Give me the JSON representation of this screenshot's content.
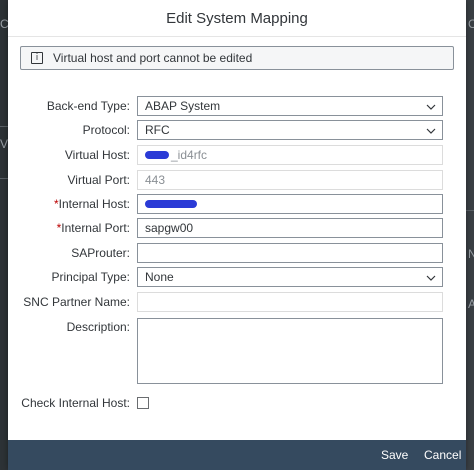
{
  "dialog": {
    "title": "Edit System Mapping"
  },
  "info": {
    "text": "Virtual host and port cannot be edited"
  },
  "form": {
    "backend_type": {
      "label": "Back-end Type:",
      "value": "ABAP System"
    },
    "protocol": {
      "label": "Protocol:",
      "value": "RFC"
    },
    "virtual_host": {
      "label": "Virtual Host:",
      "value_suffix": "_id4rfc"
    },
    "virtual_port": {
      "label": "Virtual Port:",
      "value": "443"
    },
    "internal_host": {
      "required_mark": "*",
      "label": "Internal Host:"
    },
    "internal_port": {
      "required_mark": "*",
      "label": "Internal Port:",
      "value": "sapgw00"
    },
    "saprouter": {
      "label": "SAProuter:",
      "value": ""
    },
    "principal_type": {
      "label": "Principal Type:",
      "value": "None"
    },
    "snc_partner_name": {
      "label": "SNC Partner Name:",
      "value": ""
    },
    "description": {
      "label": "Description:",
      "value": ""
    },
    "check_internal_host": {
      "label": "Check Internal Host:",
      "checked": false
    }
  },
  "footer": {
    "save_label": "Save",
    "cancel_label": "Cancel"
  },
  "background": {
    "left_frag_1": "C",
    "left_frag_2": "V",
    "right_frag_1": "C",
    "right_frag_2": "N",
    "right_frag_3": "A"
  },
  "icons": {
    "info": "info-icon",
    "dropdown": "chevron-down-icon"
  }
}
